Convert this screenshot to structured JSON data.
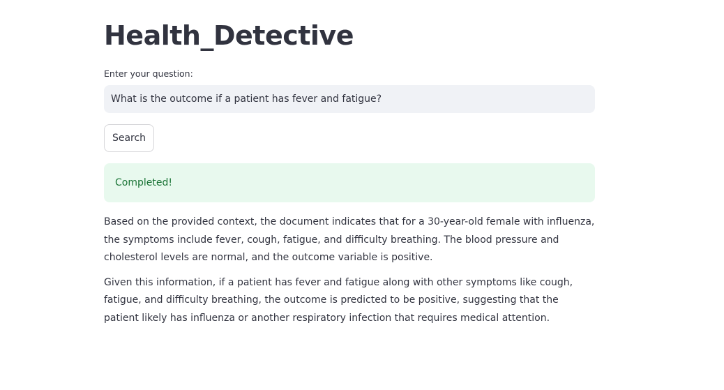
{
  "app": {
    "title": "Health_Detective"
  },
  "form": {
    "input_label": "Enter your question:",
    "question_value": "What is the outcome if a patient has fever and fatigue?",
    "search_label": "Search"
  },
  "status": {
    "message": "Completed!",
    "color": "#177233",
    "background": "#e8f9ee"
  },
  "response": {
    "paragraphs": [
      "Based on the provided context, the document indicates that for a 30-year-old female with influenza, the symptoms include fever, cough, fatigue, and difficulty breathing. The blood pressure and cholesterol levels are normal, and the outcome variable is positive.",
      "Given this information, if a patient has fever and fatigue along with other symptoms like cough, fatigue, and difficulty breathing, the outcome is predicted to be positive, suggesting that the patient likely has influenza or another respiratory infection that requires medical attention."
    ]
  }
}
